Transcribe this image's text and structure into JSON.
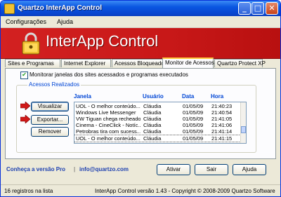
{
  "window": {
    "title": "Quartzo InterApp Control",
    "title_color": "#ffffff"
  },
  "menu": {
    "items": [
      "Configurações",
      "Ajuda"
    ]
  },
  "banner": {
    "title": "InterApp Control",
    "bg_color": "#c81818"
  },
  "tabs": [
    {
      "label": "Sites e Programas"
    },
    {
      "label": "Internet Explorer"
    },
    {
      "label": "Acessos Bloqueados"
    },
    {
      "label": "Monitor de Acessos",
      "active": true
    },
    {
      "label": "Quartzo Protect XP"
    }
  ],
  "monitor": {
    "checkbox_label": "Monitorar janelas dos sites acessados e programas executados",
    "checked": true,
    "group_label": "Acessos Realizados",
    "buttons": {
      "visualizar": "Visualizar",
      "exportar": "Exportar...",
      "remover": "Remover"
    },
    "columns": {
      "janela": "Janela",
      "usuario": "Usuário",
      "data": "Data",
      "hora": "Hora"
    },
    "rows": [
      {
        "janela": "UOL - O melhor conteúdo...",
        "usuario": "Cláudia",
        "data": "01/05/09",
        "hora": "21:40:23"
      },
      {
        "janela": "Windows Live Messenger",
        "usuario": "Cláudia",
        "data": "01/05/09",
        "hora": "21:40:54"
      },
      {
        "janela": "VW Tiguan chega recheado...",
        "usuario": "Cláudia",
        "data": "01/05/09",
        "hora": "21:41:05"
      },
      {
        "janela": "Cinema - CineClick - Notíc...",
        "usuario": "Cláudia",
        "data": "01/05/09",
        "hora": "21:41:06"
      },
      {
        "janela": "Petrobras tira com sucess...",
        "usuario": "Cláudia",
        "data": "01/05/09",
        "hora": "21:41:14"
      },
      {
        "janela": "UOL - O melhor conteúdo...",
        "usuario": "Cláudia",
        "data": "01/05/09",
        "hora": "21:41:15"
      }
    ]
  },
  "footer": {
    "link_pro": "Conheça a versão Pro",
    "separator": "|",
    "link_email": "info@quartzo.com",
    "buttons": {
      "ativar": "Ativar",
      "sair": "Sair",
      "ajuda": "Ajuda"
    }
  },
  "status": {
    "count": "16 registros na lista",
    "version": "InterApp Control versão 1.43 - Copyright © 2008-2009 Quartzo Software"
  }
}
